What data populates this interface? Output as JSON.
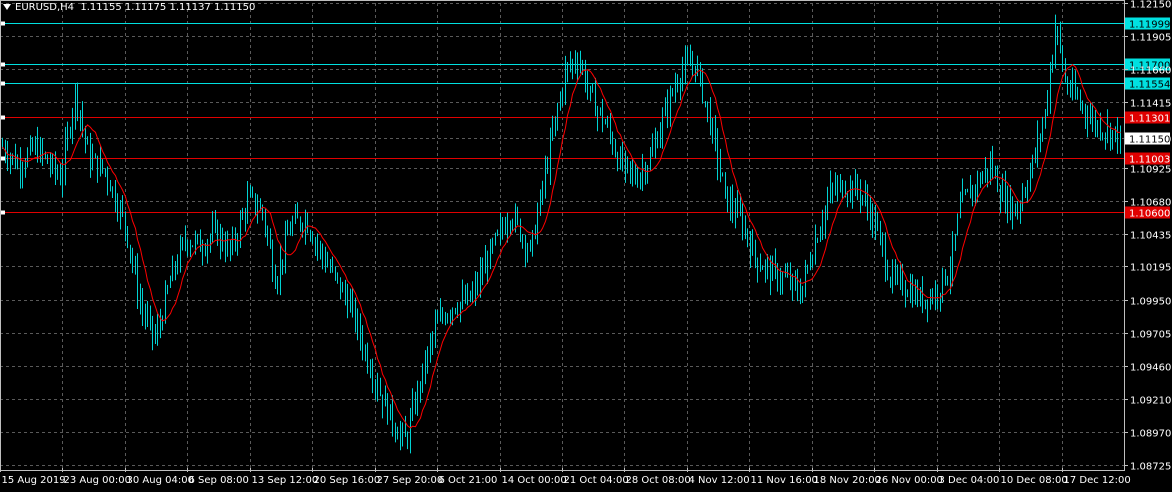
{
  "header": {
    "symbol": "EURUSD,H4",
    "open": "1.11155",
    "high": "1.11175",
    "low": "1.11137",
    "close": "1.11150"
  },
  "colors": {
    "background": "#000000",
    "grid": "#5a5a5a",
    "bull": "#00d2d2",
    "bear": "#00d2d2",
    "ma": "#ff0000",
    "resistance_line": "#00e0e0",
    "support_line": "#e00000",
    "axis_text": "#ffffff"
  },
  "chart_data": {
    "type": "candlestick",
    "symbol": "EURUSD",
    "timeframe": "H4",
    "ylim": [
      1.087,
      1.1215
    ],
    "y_ticks": [
      "1.12150",
      "1.11905",
      "1.11660",
      "1.11415",
      "1.11150",
      "1.10925",
      "1.10680",
      "1.10435",
      "1.10195",
      "1.09950",
      "1.09705",
      "1.09460",
      "1.09210",
      "1.08970",
      "1.08725"
    ],
    "x_ticks": [
      "15 Aug 2019",
      "23 Aug 00:00",
      "30 Aug 04:00",
      "6 Sep 08:00",
      "13 Sep 12:00",
      "20 Sep 16:00",
      "27 Sep 20:00",
      "6 Oct 21:00",
      "14 Oct 00:00",
      "21 Oct 04:00",
      "28 Oct 08:00",
      "4 Nov 12:00",
      "11 Nov 16:00",
      "18 Nov 20:00",
      "26 Nov 00:00",
      "3 Dec 04:00",
      "10 Dec 08:00",
      "17 Dec 12:00"
    ],
    "grid": true,
    "current_price": "1.11150",
    "horizontal_lines": [
      {
        "price": "1.11999",
        "role": "resistance",
        "color": "#00e0e0"
      },
      {
        "price": "1.11700",
        "role": "resistance",
        "color": "#00e0e0"
      },
      {
        "price": "1.11554",
        "role": "resistance",
        "color": "#00e0e0"
      },
      {
        "price": "1.11301",
        "role": "support",
        "color": "#e00000"
      },
      {
        "price": "1.11003",
        "role": "support",
        "color": "#e00000"
      },
      {
        "price": "1.10600",
        "role": "support",
        "color": "#e00000"
      }
    ],
    "price_path": [
      [
        0,
        1.111
      ],
      [
        18,
        1.1095
      ],
      [
        35,
        1.1108
      ],
      [
        60,
        1.1085
      ],
      [
        75,
        1.115
      ],
      [
        88,
        1.11
      ],
      [
        105,
        1.109
      ],
      [
        125,
        1.105
      ],
      [
        140,
        1.099
      ],
      [
        155,
        1.0965
      ],
      [
        170,
        1.101
      ],
      [
        185,
        1.104
      ],
      [
        200,
        1.1035
      ],
      [
        215,
        1.1045
      ],
      [
        230,
        1.103
      ],
      [
        248,
        1.107
      ],
      [
        262,
        1.106
      ],
      [
        275,
        1.101
      ],
      [
        290,
        1.105
      ],
      [
        305,
        1.1055
      ],
      [
        320,
        1.103
      ],
      [
        335,
        1.101
      ],
      [
        350,
        1.099
      ],
      [
        365,
        1.0955
      ],
      [
        380,
        1.0925
      ],
      [
        395,
        1.09
      ],
      [
        405,
        1.089
      ],
      [
        420,
        1.0935
      ],
      [
        435,
        1.0975
      ],
      [
        450,
        1.099
      ],
      [
        470,
        1.0995
      ],
      [
        490,
        1.103
      ],
      [
        510,
        1.106
      ],
      [
        530,
        1.103
      ],
      [
        550,
        1.111
      ],
      [
        565,
        1.1165
      ],
      [
        578,
        1.1175
      ],
      [
        590,
        1.1145
      ],
      [
        605,
        1.1125
      ],
      [
        620,
        1.1095
      ],
      [
        635,
        1.1085
      ],
      [
        650,
        1.11
      ],
      [
        665,
        1.1135
      ],
      [
        680,
        1.1165
      ],
      [
        695,
        1.117
      ],
      [
        710,
        1.1125
      ],
      [
        725,
        1.107
      ],
      [
        740,
        1.1055
      ],
      [
        755,
        1.1025
      ],
      [
        770,
        1.1015
      ],
      [
        785,
        1.101
      ],
      [
        800,
        1.1
      ],
      [
        815,
        1.104
      ],
      [
        830,
        1.1075
      ],
      [
        845,
        1.108
      ],
      [
        860,
        1.1075
      ],
      [
        875,
        1.105
      ],
      [
        890,
        1.101
      ],
      [
        905,
        1.1005
      ],
      [
        920,
        1.0995
      ],
      [
        935,
        1.1
      ],
      [
        950,
        1.102
      ],
      [
        960,
        1.1065
      ],
      [
        975,
        1.108
      ],
      [
        990,
        1.1095
      ],
      [
        1000,
        1.1075
      ],
      [
        1015,
        1.106
      ],
      [
        1030,
        1.109
      ],
      [
        1045,
        1.1135
      ],
      [
        1055,
        1.12
      ],
      [
        1065,
        1.1155
      ],
      [
        1080,
        1.114
      ],
      [
        1095,
        1.1125
      ],
      [
        1110,
        1.112
      ],
      [
        1120,
        1.1115
      ]
    ]
  }
}
